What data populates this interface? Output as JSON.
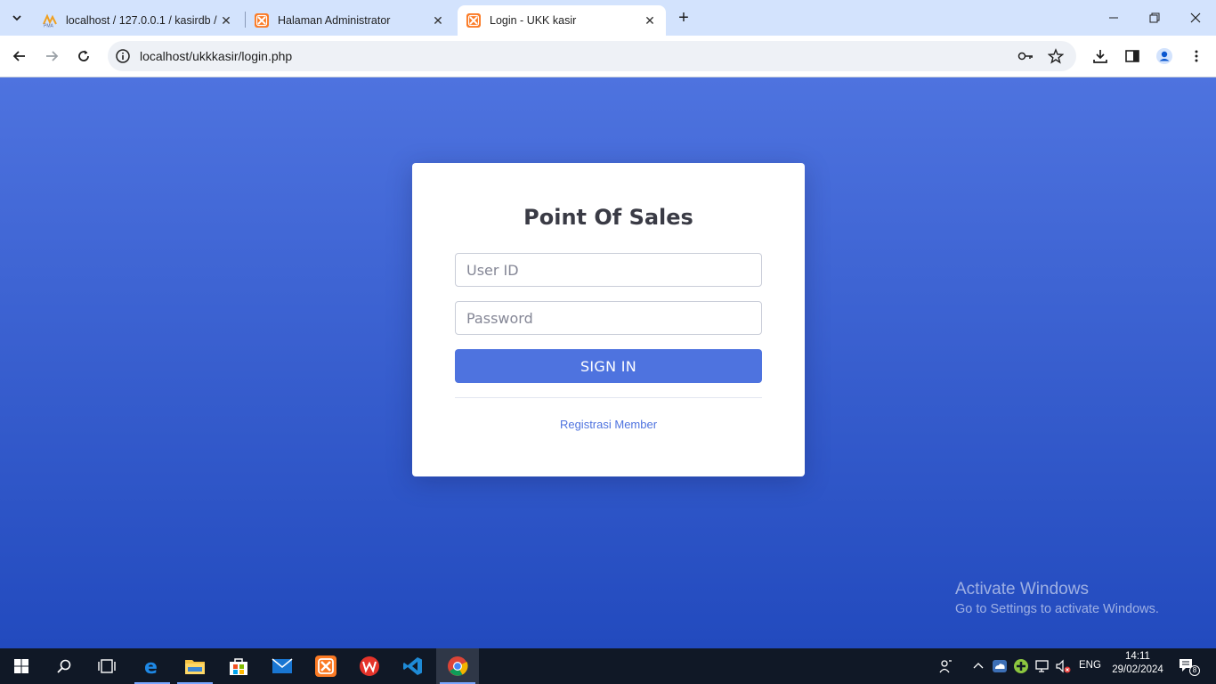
{
  "browser": {
    "tabs": [
      {
        "title": "localhost / 127.0.0.1 / kasirdb /",
        "favicon": "phpmyadmin-icon"
      },
      {
        "title": "Halaman Administrator",
        "favicon": "xampp-icon"
      },
      {
        "title": "Login - UKK kasir",
        "favicon": "xampp-icon",
        "active": true
      }
    ],
    "url": "localhost/ukkkasir/login.php"
  },
  "login": {
    "title": "Point Of Sales",
    "userid_placeholder": "User ID",
    "password_placeholder": "Password",
    "signin_label": "SIGN IN",
    "register_link": "Registrasi Member"
  },
  "watermark": {
    "line1": "Activate Windows",
    "line2": "Go to Settings to activate Windows."
  },
  "taskbar": {
    "language": "ENG",
    "time": "14:11",
    "date": "29/02/2024",
    "notification_count": "8"
  },
  "colors": {
    "primary": "#4e73df",
    "gradient_end": "#224abe",
    "tabstrip": "#d3e3fd"
  }
}
